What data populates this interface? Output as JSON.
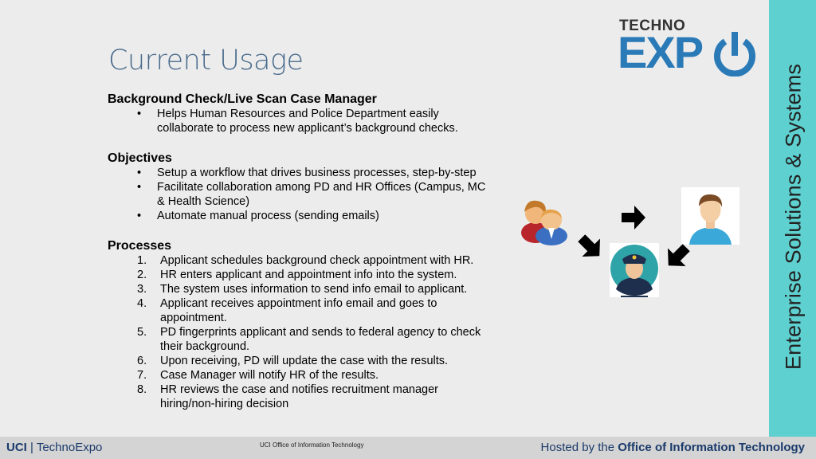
{
  "title": "Current Usage",
  "sidebar_text": "Enterprise Solutions & Systems",
  "logo": {
    "top": "TECHNO",
    "main": "EXP"
  },
  "section1": {
    "heading": "Background Check/Live Scan Case Manager",
    "bullets": [
      "Helps Human Resources and Police Department easily",
      "collaborate to process new applicant’s background checks."
    ]
  },
  "section2": {
    "heading": "Objectives",
    "bullets": [
      "Setup a workflow that drives business processes, step-by-step",
      "Facilitate collaboration among PD and HR Offices (Campus, MC",
      "& Health Science)",
      "Automate manual process (sending emails)"
    ]
  },
  "section3": {
    "heading": "Processes",
    "steps": [
      {
        "num": "1.",
        "text": "Applicant schedules background check appointment with HR."
      },
      {
        "num": "2.",
        "text": "HR enters applicant and appointment info into the system."
      },
      {
        "num": "3.",
        "text": "The system uses information to send info email to applicant."
      },
      {
        "num": "4.",
        "text": "Applicant receives appointment info email and goes to"
      },
      {
        "num": "",
        "text": "appointment."
      },
      {
        "num": "5.",
        "text": "PD fingerprints applicant and sends to federal agency to check"
      },
      {
        "num": "",
        "text": "their background."
      },
      {
        "num": "6.",
        "text": "Upon receiving, PD will update the case with the results."
      },
      {
        "num": "7.",
        "text": "Case Manager will notify HR of the results."
      },
      {
        "num": "8.",
        "text": "HR reviews the case and notifies recruitment manager"
      },
      {
        "num": "",
        "text": "hiring/non-hiring decision"
      }
    ]
  },
  "footer": {
    "left_brand": "UCI",
    "left_sep": "|",
    "left_name": "TechnoExpo",
    "center": "UCI Office of Information Technology",
    "right_prefix": "Hosted by the",
    "right_bold": "Office of Information Technology"
  },
  "icons": {
    "hr": "users-icon",
    "applicant": "person-icon",
    "police": "police-officer-icon",
    "arrow": "arrow-icon"
  },
  "colors": {
    "sidebar": "#5fd0d0",
    "title": "#4a6b8c",
    "logo_blue": "#2a7ab8",
    "footer_text": "#1a3a6b"
  }
}
